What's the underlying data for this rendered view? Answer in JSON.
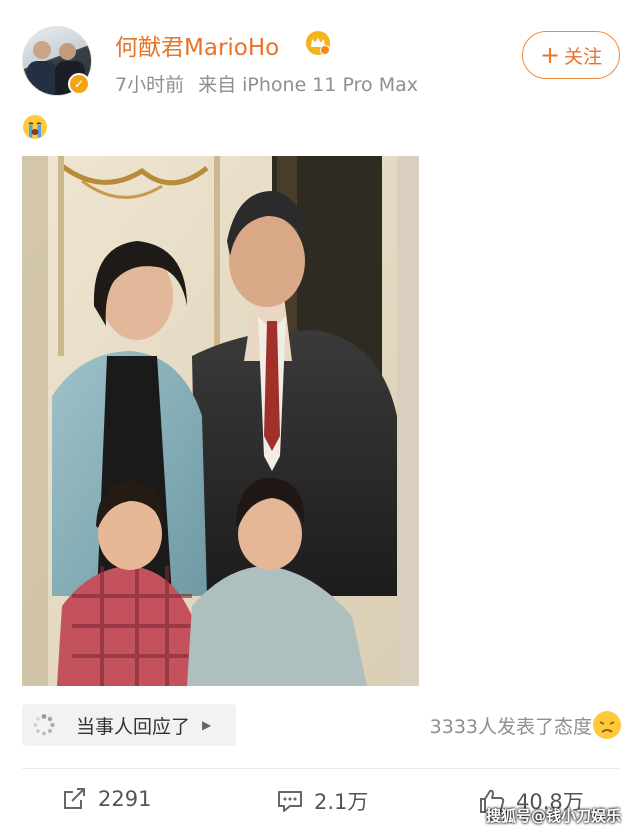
{
  "post": {
    "author": {
      "name": "何猷君MarioHo",
      "verified_icon": "verified-badge-icon",
      "level_icon": "crown-badge-icon"
    },
    "time": "7小时前",
    "source": "来自 iPhone 11 Pro Max",
    "follow_label": "关注",
    "text_emoji": "crying-face-emoji",
    "photo": {
      "type": "family-portrait"
    },
    "topic_tag": "当事人回应了",
    "reactions_text": "3333人发表了态度",
    "actions": {
      "repost_count": "2291",
      "comment_count": "2.1万",
      "like_count": "40.8万"
    },
    "watermark": "搜狐号@钱小刀娱乐"
  },
  "colors": {
    "accent": "#e8742a",
    "meta": "#8f8f8f",
    "verified": "#f3a415"
  }
}
